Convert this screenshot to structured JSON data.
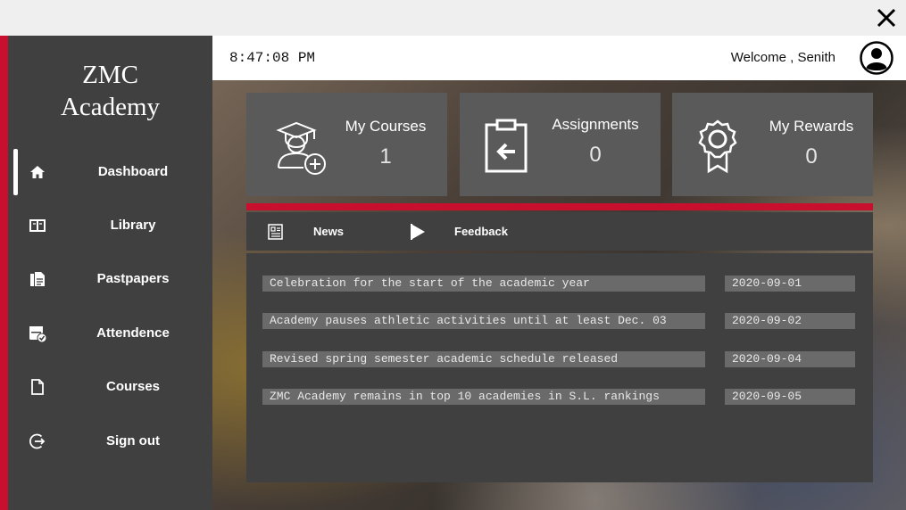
{
  "window": {
    "close_icon": "close-icon"
  },
  "sidebar": {
    "brand_line1": "ZMC",
    "brand_line2": "Academy",
    "accent_color": "#c8102e",
    "items": [
      {
        "label": "Dashboard",
        "icon": "home-icon",
        "active": true
      },
      {
        "label": "Library",
        "icon": "book-icon",
        "active": false
      },
      {
        "label": "Pastpapers",
        "icon": "document-icon",
        "active": false
      },
      {
        "label": "Attendence",
        "icon": "calendar-check-icon",
        "active": false
      },
      {
        "label": "Courses",
        "icon": "file-icon",
        "active": false
      },
      {
        "label": "Sign out",
        "icon": "sign-out-icon",
        "active": false
      }
    ]
  },
  "header": {
    "time": "8:47:08 PM",
    "welcome": "Welcome , Senith",
    "avatar_icon": "user-avatar-icon"
  },
  "cards": [
    {
      "title": "My Courses",
      "value": "1",
      "icon": "graduate-add-icon"
    },
    {
      "title": "Assignments",
      "value": "0",
      "icon": "clipboard-icon"
    },
    {
      "title": "My Rewards",
      "value": "0",
      "icon": "award-badge-icon"
    }
  ],
  "tabs": [
    {
      "label": "News",
      "icon": "newspaper-icon"
    },
    {
      "label": "Feedback",
      "icon": "flag-icon"
    }
  ],
  "news": [
    {
      "title": "Celebration for the start of the academic year",
      "date": "2020-09-01"
    },
    {
      "title": "Academy pauses athletic activities until at least Dec. 03",
      "date": "2020-09-02"
    },
    {
      "title": "Revised spring semester academic schedule released",
      "date": "2020-09-04"
    },
    {
      "title": "ZMC Academy remains in top 10 academies in S.L. rankings",
      "date": "2020-09-05"
    }
  ]
}
